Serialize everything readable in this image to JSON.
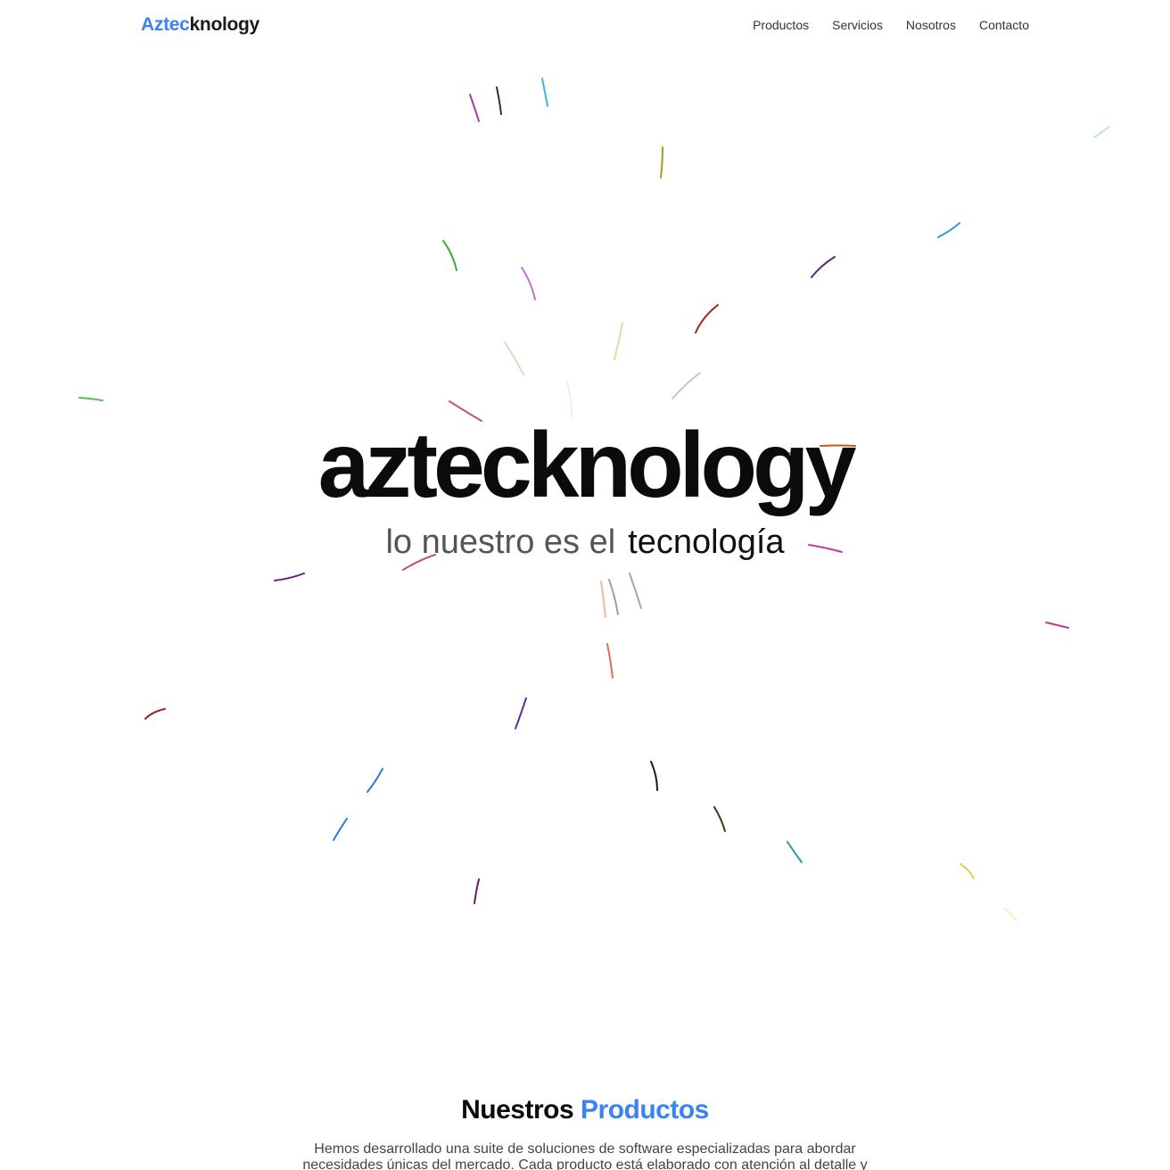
{
  "header": {
    "logo_accent": "Aztec",
    "logo_rest": "knology",
    "nav": [
      {
        "label": "Productos"
      },
      {
        "label": "Servicios"
      },
      {
        "label": "Nosotros"
      },
      {
        "label": "Contacto"
      }
    ]
  },
  "hero": {
    "title": "aztecknology",
    "subtitle_lead": "lo nuestro es el",
    "subtitle_word": "tecnología"
  },
  "products": {
    "title_plain": "Nuestros",
    "title_accent": "Productos",
    "description": "Hemos desarrollado una suite de soluciones de software especializadas para abordar necesidades únicas del mercado. Cada producto está elaborado con atención al detalle y"
  },
  "colors": {
    "accent": "#3b82f6",
    "text": "#111111"
  }
}
